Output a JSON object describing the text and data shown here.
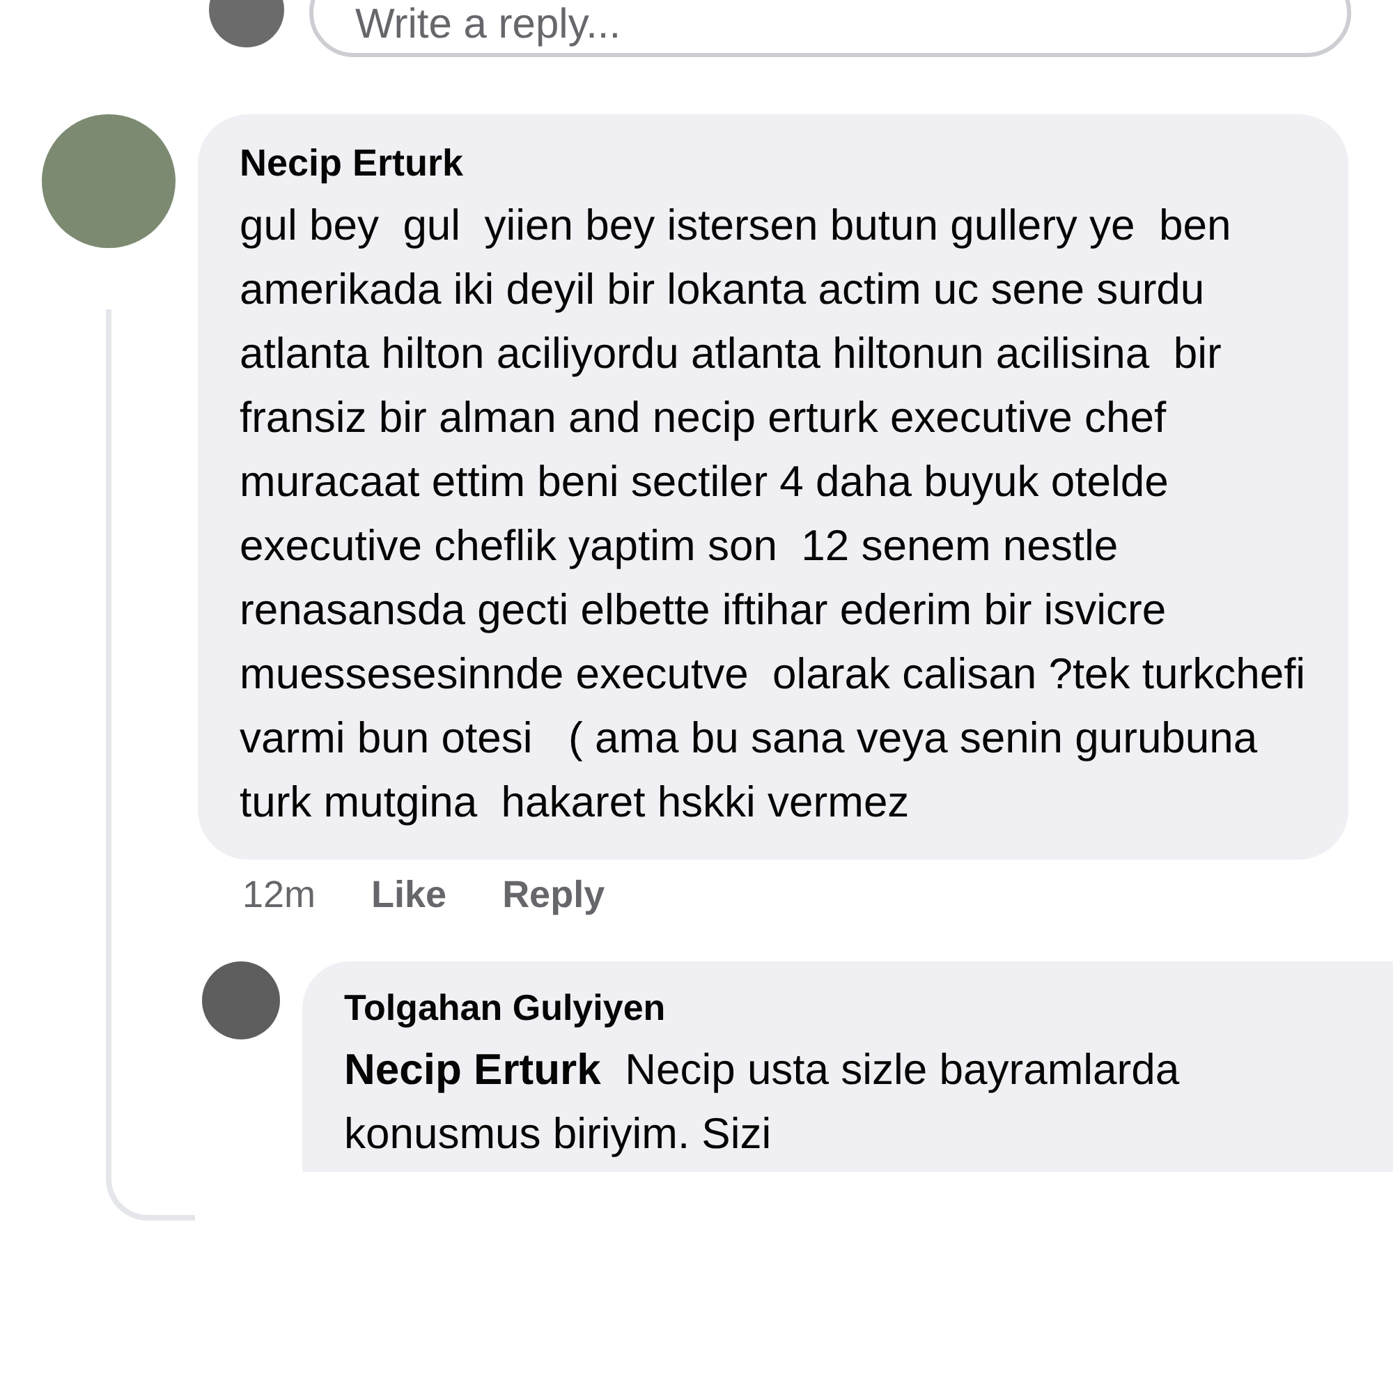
{
  "reply_composer": {
    "placeholder": "Write a reply..."
  },
  "comment": {
    "author": "Necip Erturk",
    "text": "gul bey  gul  yiien bey istersen butun gullery ye  ben amerikada iki deyil bir lokanta actim uc sene surdu atlanta hilton aciliyordu atlanta hiltonun acilisina  bir fransiz bir alman and necip erturk executive chef muracaat ettim beni sectiler 4 daha buyuk otelde   executive cheflik yaptim son  12 senem nestle  renasansda gecti elbette iftihar ederim bir isvicre muessesesinnde executve  olarak calisan ?tek turkchefi varmi bun otesi   ( ama bu sana veya senin gurubuna  turk mutgina  hakaret hskki vermez",
    "time": "12m",
    "actions": [
      "Like",
      "Reply"
    ]
  },
  "reply": {
    "author": "Tolgahan Gulyiyen",
    "text": "**Necip Erturk**  Necip usta sizle bayramlarda konusmus biriyim. Sizi"
  }
}
